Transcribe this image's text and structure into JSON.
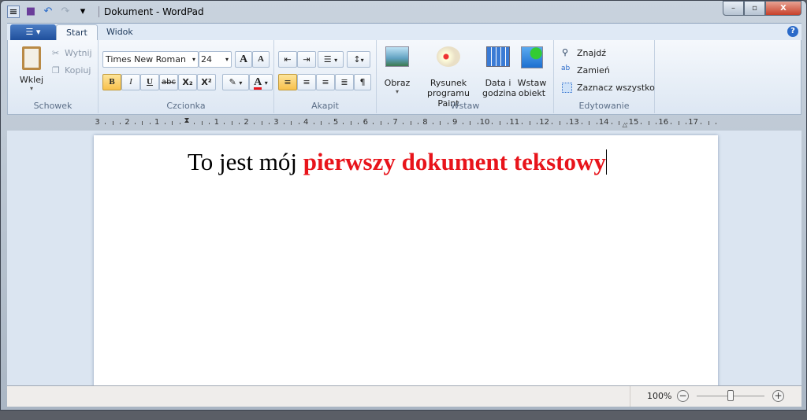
{
  "title": "Dokument - WordPad",
  "quick_access": {
    "save": "save-icon",
    "undo": "undo-icon",
    "redo": "redo-icon",
    "customize": "▾"
  },
  "window_buttons": {
    "minimize": "–",
    "maximize": "▫",
    "close": "X"
  },
  "tabs": [
    {
      "label": "Start",
      "active": true
    },
    {
      "label": "Widok",
      "active": false
    }
  ],
  "app_menu": "☰ ▾",
  "help": "?",
  "ribbon": {
    "clipboard": {
      "label": "Schowek",
      "paste": "Wklej",
      "cut": "Wytnij",
      "copy": "Kopiuj"
    },
    "font": {
      "label": "Czcionka",
      "family": "Times New Roman",
      "size": "24",
      "grow": "A",
      "shrink": "A",
      "bold": "B",
      "italic": "I",
      "underline": "U",
      "strike": "abc",
      "subscript": "X₂",
      "superscript": "X²",
      "highlight": "✎",
      "color": "A",
      "active_color": "#e8141b"
    },
    "paragraph": {
      "label": "Akapit"
    },
    "insert": {
      "label": "Wstaw",
      "picture": "Obraz",
      "paint_1": "Rysunek",
      "paint_2": "programu Paint",
      "datetime_1": "Data i",
      "datetime_2": "godzina",
      "object_1": "Wstaw",
      "object_2": "obiekt"
    },
    "editing": {
      "label": "Edytowanie",
      "find": "Znajdź",
      "replace": "Zamień",
      "select_all": "Zaznacz wszystko"
    }
  },
  "ruler": [
    "3",
    "2",
    "1",
    "1",
    "2",
    "3",
    "4",
    "5",
    "6",
    "7",
    "8",
    "9",
    "10",
    "11",
    "12",
    "13",
    "14",
    "15",
    "16",
    "17"
  ],
  "document": {
    "text_plain": "To jest mój ",
    "text_red": "pierwszy dokument tekstowy"
  },
  "status": {
    "zoom": "100%",
    "zoom_level_percent": 100,
    "zoom_out": "−",
    "zoom_in": "+"
  }
}
